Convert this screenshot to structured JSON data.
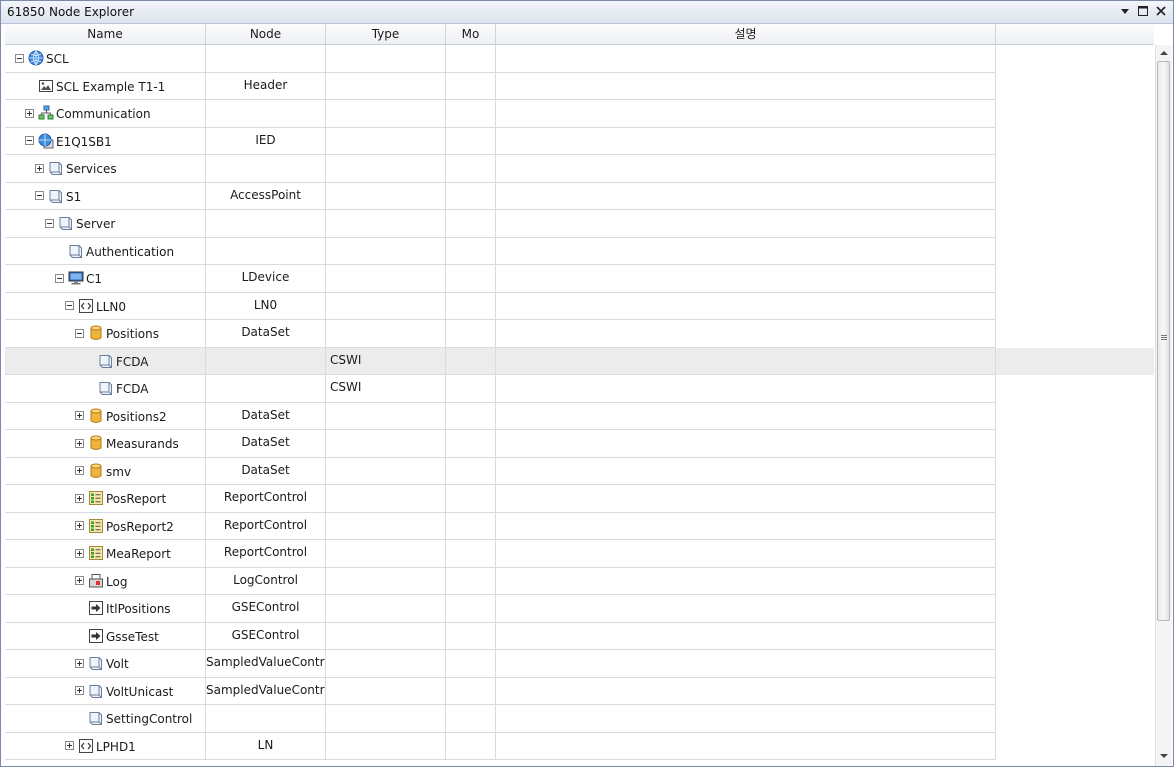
{
  "window": {
    "title": "61850 Node Explorer"
  },
  "columns": [
    "Name",
    "Node",
    "Type",
    "Mo",
    "설명"
  ],
  "rows": [
    {
      "label": "SCL",
      "node": "",
      "type": "",
      "level": 0,
      "toggle": "minus",
      "icon": "globe-icon"
    },
    {
      "label": "SCL Example T1-1",
      "node": "Header",
      "type": "",
      "level": 1,
      "toggle": "none",
      "icon": "image-icon"
    },
    {
      "label": "Communication",
      "node": "",
      "type": "",
      "level": 1,
      "toggle": "plus",
      "icon": "network-icon"
    },
    {
      "label": "E1Q1SB1",
      "node": "IED",
      "type": "",
      "level": 1,
      "toggle": "minus",
      "icon": "ied-globe-icon"
    },
    {
      "label": "Services",
      "node": "",
      "type": "",
      "level": 2,
      "toggle": "plus",
      "icon": "book-icon"
    },
    {
      "label": "S1",
      "node": "AccessPoint",
      "type": "",
      "level": 2,
      "toggle": "minus",
      "icon": "book-icon"
    },
    {
      "label": "Server",
      "node": "",
      "type": "",
      "level": 3,
      "toggle": "minus",
      "icon": "book-icon"
    },
    {
      "label": "Authentication",
      "node": "",
      "type": "",
      "level": 4,
      "toggle": "none",
      "icon": "book-icon"
    },
    {
      "label": "C1",
      "node": "LDevice",
      "type": "",
      "level": 4,
      "toggle": "minus",
      "icon": "monitor-icon"
    },
    {
      "label": "LLN0",
      "node": "LN0",
      "type": "",
      "level": 5,
      "toggle": "minus",
      "icon": "code-icon"
    },
    {
      "label": "Positions",
      "node": "DataSet",
      "type": "",
      "level": 6,
      "toggle": "minus",
      "icon": "database-icon"
    },
    {
      "label": "FCDA",
      "node": "",
      "type": "CSWI",
      "level": 7,
      "toggle": "none",
      "icon": "book-icon",
      "selected": true
    },
    {
      "label": "FCDA",
      "node": "",
      "type": "CSWI",
      "level": 7,
      "toggle": "none",
      "icon": "book-icon"
    },
    {
      "label": "Positions2",
      "node": "DataSet",
      "type": "",
      "level": 6,
      "toggle": "plus",
      "icon": "database-icon"
    },
    {
      "label": "Measurands",
      "node": "DataSet",
      "type": "",
      "level": 6,
      "toggle": "plus",
      "icon": "database-icon"
    },
    {
      "label": "smv",
      "node": "DataSet",
      "type": "",
      "level": 6,
      "toggle": "plus",
      "icon": "database-icon"
    },
    {
      "label": "PosReport",
      "node": "ReportControl",
      "type": "",
      "level": 6,
      "toggle": "plus",
      "icon": "report-icon"
    },
    {
      "label": "PosReport2",
      "node": "ReportControl",
      "type": "",
      "level": 6,
      "toggle": "plus",
      "icon": "report-icon"
    },
    {
      "label": "MeaReport",
      "node": "ReportControl",
      "type": "",
      "level": 6,
      "toggle": "plus",
      "icon": "report-icon"
    },
    {
      "label": "Log",
      "node": "LogControl",
      "type": "",
      "level": 6,
      "toggle": "plus",
      "icon": "log-icon"
    },
    {
      "label": "ItlPositions",
      "node": "GSEControl",
      "type": "",
      "level": 6,
      "toggle": "none",
      "icon": "gse-arrow-icon"
    },
    {
      "label": "GsseTest",
      "node": "GSEControl",
      "type": "",
      "level": 6,
      "toggle": "none",
      "icon": "gse-arrow-icon"
    },
    {
      "label": "Volt",
      "node": "SampledValueContrc",
      "type": "",
      "level": 6,
      "toggle": "plus",
      "icon": "book-icon"
    },
    {
      "label": "VoltUnicast",
      "node": "SampledValueContrc",
      "type": "",
      "level": 6,
      "toggle": "plus",
      "icon": "book-icon"
    },
    {
      "label": "SettingControl",
      "node": "",
      "type": "",
      "level": 6,
      "toggle": "none",
      "icon": "book-icon"
    },
    {
      "label": "LPHD1",
      "node": "LN",
      "type": "",
      "level": 5,
      "toggle": "plus",
      "icon": "code-icon"
    }
  ]
}
